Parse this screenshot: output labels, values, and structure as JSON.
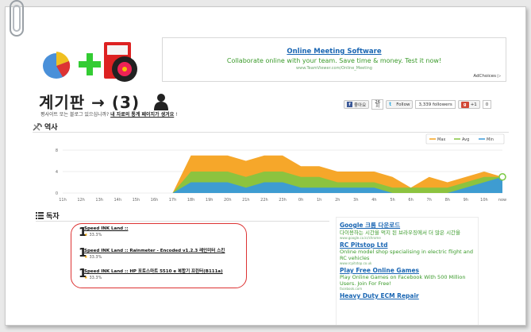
{
  "ad_top": {
    "title": "Online Meeting Software",
    "text": "Collaborate online with your team. Save time & money. Test it now!",
    "url": "www.TeamViewer.com/Online_Meeting",
    "adchoices": "AdChoices"
  },
  "header": {
    "title": "계기판 → (3)",
    "subtitle_text": "평사이트 또는 블로그 있으십니까?",
    "subtitle_link": "내 자료의 통계 페이지가 생겨요",
    "subtitle_tail": "!"
  },
  "social": {
    "fb_label": "좋아요",
    "fb_count": "26",
    "fb_count2": "회",
    "tw_label": "Follow",
    "tw_followers": "3,339 followers",
    "gp_label": "+1",
    "gp_count": "0"
  },
  "sections": {
    "history": "역사",
    "readers": "독자"
  },
  "chart_data": {
    "type": "area",
    "legend": [
      "Max",
      "Avg",
      "Min"
    ],
    "legend_position": "top-right",
    "colors": {
      "Max": "#f5a21f",
      "Avg": "#86c440",
      "Min": "#3a9ad9"
    },
    "categories": [
      "11h",
      "12h",
      "13h",
      "14h",
      "15h",
      "16h",
      "17h",
      "18h",
      "19h",
      "20h",
      "21h",
      "22h",
      "23h",
      "0h",
      "1h",
      "2h",
      "3h",
      "4h",
      "5h",
      "6h",
      "7h",
      "8h",
      "9h",
      "10h",
      "now"
    ],
    "yticks": [
      "0",
      "4",
      "8"
    ],
    "ylim": [
      0,
      8
    ],
    "series": [
      {
        "name": "Max",
        "values": [
          0,
          0,
          0,
          0,
          0,
          0,
          0,
          7,
          7,
          7,
          6,
          7,
          7,
          5,
          5,
          4,
          4,
          4,
          3,
          1,
          3,
          2,
          3,
          4,
          3
        ]
      },
      {
        "name": "Avg",
        "values": [
          0,
          0,
          0,
          0,
          0,
          0,
          0,
          4,
          4,
          4,
          3,
          4,
          4,
          3,
          3,
          2,
          2,
          2,
          1,
          1,
          1,
          1,
          2,
          3,
          3
        ]
      },
      {
        "name": "Min",
        "values": [
          0,
          0,
          0,
          0,
          0,
          0,
          0,
          2,
          2,
          2,
          1,
          2,
          2,
          1,
          1,
          1,
          1,
          1,
          0,
          0,
          0,
          0,
          1,
          2,
          3
        ]
      }
    ]
  },
  "readers": [
    {
      "num": "1",
      "name": "Speed INK Land ::",
      "rating": "33.3%"
    },
    {
      "num": "1",
      "name": "Speed INK Land :: Rainmeter - Encoded v1.2.3 레인미터 스킨",
      "rating": "33.3%"
    },
    {
      "num": "1",
      "name": "Speed INK Land :: HP 포토스마트 5510 e 복합기 프린터(B111a)",
      "rating": "33.3%"
    }
  ],
  "ads_right": [
    {
      "title": "Google 크롬 다운로드",
      "desc": "다이용하는 시간을 먹지 된 브라우징에서 더 많은 시간을",
      "url": "www.google.co.kr/chrome"
    },
    {
      "title": "RC Pitstop Ltd",
      "desc": "Online model shop specialising in electric flight and RC vehicles",
      "url": "www.rcpitstop.co.uk"
    },
    {
      "title": "Play Free Online Games",
      "desc": "Play Online Games on Facebook With 500 Million Users. Join For Free!",
      "url": "facebook.com"
    },
    {
      "title": "Heavy Duty ECM Repair",
      "desc": "",
      "url": ""
    }
  ]
}
